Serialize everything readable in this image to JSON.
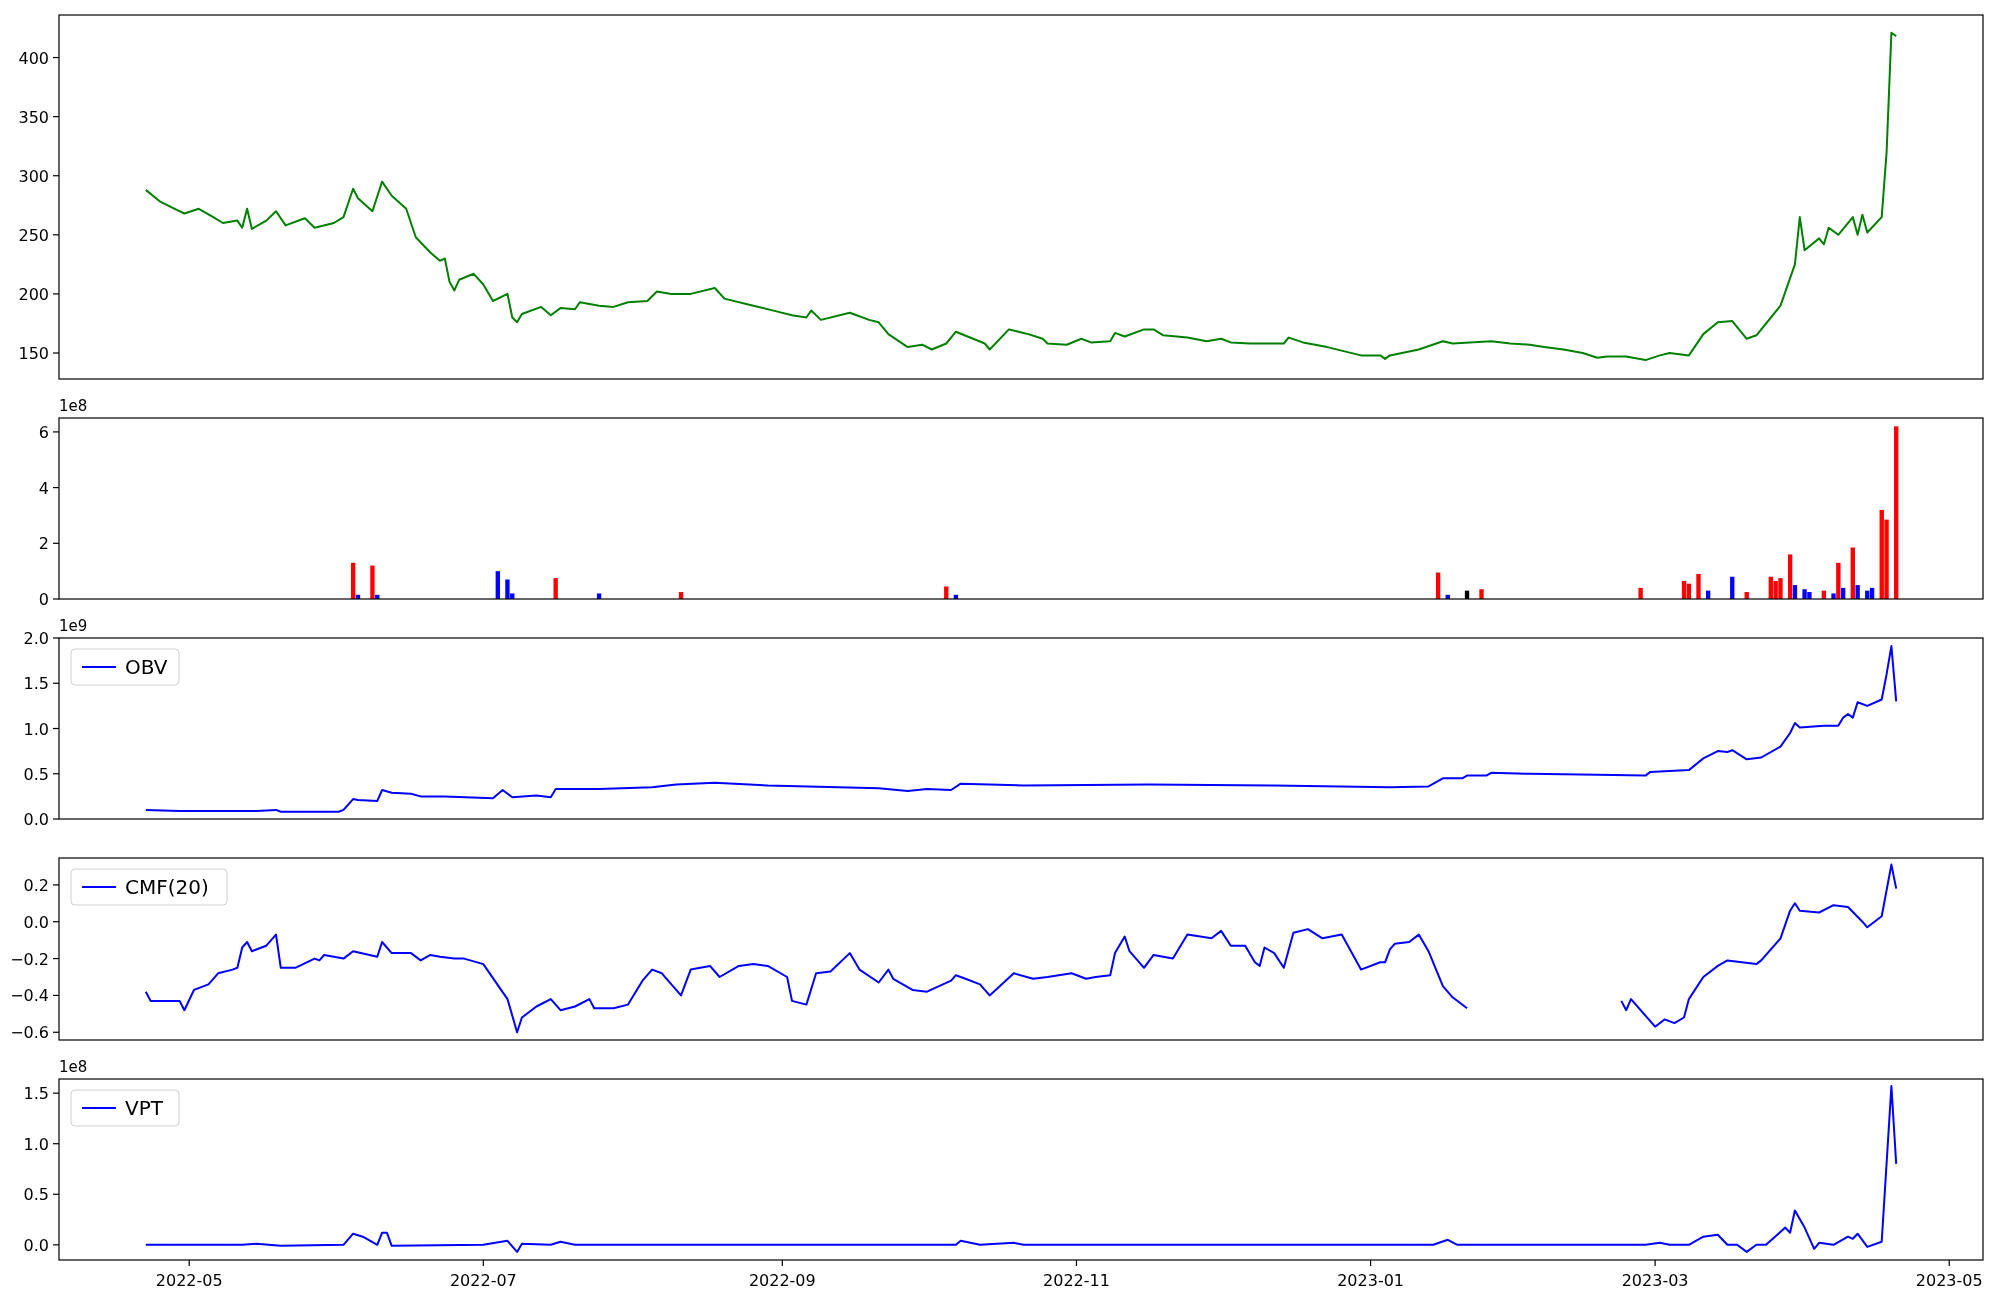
{
  "panels": [
    {
      "chart_data": {
        "type": "line",
        "xlim": [
          "2022-04-04",
          "2023-05-08"
        ],
        "ylim": [
          128,
          436
        ],
        "yticks": [
          150,
          200,
          250,
          300,
          350,
          400
        ],
        "series": [
          {
            "color": "#008000",
            "values": [
              288,
              278,
              272,
              268,
              272,
              265,
              260,
              262,
              256,
              272,
              255,
              262,
              270,
              258,
              264,
              256,
              260,
              265,
              289,
              281,
              270,
              295,
              283,
              272,
              248,
              235,
              228,
              230,
              210,
              203,
              212,
              217,
              208,
              194,
              200,
              180,
              176,
              183,
              189,
              182,
              188,
              187,
              193,
              190,
              189,
              193,
              194,
              202,
              200,
              200,
              205,
              196,
              190,
              185,
              182,
              180,
              186,
              178,
              184,
              178,
              176,
              166,
              155,
              157,
              153,
              158,
              168,
              158,
              153,
              170,
              166,
              162,
              158,
              157,
              162,
              159,
              160,
              167,
              164,
              170,
              170,
              165,
              163,
              160,
              162,
              159,
              158,
              158,
              163,
              159,
              155,
              148,
              148,
              145,
              148,
              153,
              160,
              158,
              160,
              158,
              157,
              155,
              153,
              150,
              146,
              147,
              147,
              144,
              148,
              150,
              148,
              166,
              176,
              177,
              162,
              165,
              190,
              225,
              265,
              237,
              247,
              242,
              256,
              250,
              265,
              250,
              267,
              252,
              265,
              320,
              421,
              418
            ]
          }
        ],
        "x": [
          "2022-04-22",
          "2022-04-25",
          "2022-04-28",
          "2022-04-30",
          "2022-05-03",
          "2022-05-06",
          "2022-05-08",
          "2022-05-11",
          "2022-05-12",
          "2022-05-13",
          "2022-05-14",
          "2022-05-17",
          "2022-05-19",
          "2022-05-21",
          "2022-05-25",
          "2022-05-27",
          "2022-05-31",
          "2022-06-02",
          "2022-06-04",
          "2022-06-05",
          "2022-06-08",
          "2022-06-10",
          "2022-06-12",
          "2022-06-15",
          "2022-06-17",
          "2022-06-20",
          "2022-06-22",
          "2022-06-23",
          "2022-06-24",
          "2022-06-25",
          "2022-06-26",
          "2022-06-29",
          "2022-07-01",
          "2022-07-03",
          "2022-07-06",
          "2022-07-07",
          "2022-07-08",
          "2022-07-09",
          "2022-07-13",
          "2022-07-15",
          "2022-07-17",
          "2022-07-20",
          "2022-07-21",
          "2022-07-25",
          "2022-07-28",
          "2022-07-31",
          "2022-08-04",
          "2022-08-06",
          "2022-08-09",
          "2022-08-13",
          "2022-08-18",
          "2022-08-20",
          "2022-08-26",
          "2022-08-31",
          "2022-09-03",
          "2022-09-06",
          "2022-09-07",
          "2022-09-09",
          "2022-09-15",
          "2022-09-19",
          "2022-09-21",
          "2022-09-23",
          "2022-09-27",
          "2022-09-30",
          "2022-10-02",
          "2022-10-05",
          "2022-10-07",
          "2022-10-13",
          "2022-10-14",
          "2022-10-18",
          "2022-10-22",
          "2022-10-25",
          "2022-10-26",
          "2022-10-30",
          "2022-11-02",
          "2022-11-04",
          "2022-11-08",
          "2022-11-09",
          "2022-11-11",
          "2022-11-15",
          "2022-11-17",
          "2022-11-19",
          "2022-11-24",
          "2022-11-28",
          "2022-12-01",
          "2022-12-03",
          "2022-12-07",
          "2022-12-14",
          "2022-12-15",
          "2022-12-18",
          "2022-12-23",
          "2022-12-30",
          "2023-01-03",
          "2023-01-04",
          "2023-01-05",
          "2023-01-11",
          "2023-01-16",
          "2023-01-18",
          "2023-01-26",
          "2023-01-30",
          "2023-02-03",
          "2023-02-06",
          "2023-02-10",
          "2023-02-14",
          "2023-02-17",
          "2023-02-19",
          "2023-02-23",
          "2023-02-27",
          "2023-03-02",
          "2023-03-04",
          "2023-03-08",
          "2023-03-11",
          "2023-03-14",
          "2023-03-17",
          "2023-03-20",
          "2023-03-22",
          "2023-03-27",
          "2023-03-30",
          "2023-03-31",
          "2023-04-01",
          "2023-04-04",
          "2023-04-05",
          "2023-04-06",
          "2023-04-08",
          "2023-04-11",
          "2023-04-12",
          "2023-04-13",
          "2023-04-14",
          "2023-04-17",
          "2023-04-18",
          "2023-04-19",
          "2023-04-20"
        ]
      }
    },
    {
      "offset_label": "1e8",
      "chart_data": {
        "type": "bar",
        "xlim": [
          "2022-04-04",
          "2023-05-08"
        ],
        "ylim": [
          0,
          6.5
        ],
        "yticks": [
          0,
          2,
          4,
          6
        ],
        "x": [
          "2022-06-04",
          "2022-06-05",
          "2022-06-08",
          "2022-06-09",
          "2022-07-04",
          "2022-07-06",
          "2022-07-07",
          "2022-07-16",
          "2022-07-25",
          "2022-08-11",
          "2022-10-05",
          "2022-10-07",
          "2023-01-15",
          "2023-01-17",
          "2023-01-21",
          "2023-01-24",
          "2023-02-26",
          "2023-03-07",
          "2023-03-08",
          "2023-03-10",
          "2023-03-12",
          "2023-03-17",
          "2023-03-20",
          "2023-03-25",
          "2023-03-26",
          "2023-03-27",
          "2023-03-29",
          "2023-03-30",
          "2023-04-01",
          "2023-04-02",
          "2023-04-05",
          "2023-04-07",
          "2023-04-08",
          "2023-04-09",
          "2023-04-11",
          "2023-04-12",
          "2023-04-14",
          "2023-04-15",
          "2023-04-17",
          "2023-04-18",
          "2023-04-20"
        ],
        "series": [
          {
            "color": "#ff0000",
            "values": [
              1.3,
              null,
              1.2,
              null,
              null,
              null,
              null,
              0.75,
              null,
              0.25,
              0.45,
              null,
              0.95,
              null,
              null,
              0.35,
              0.4,
              0.65,
              0.55,
              0.9,
              null,
              null,
              0.25,
              0.8,
              0.65,
              0.75,
              1.6,
              null,
              null,
              null,
              0.3,
              null,
              1.3,
              null,
              1.85,
              null,
              null,
              null,
              3.2,
              2.85,
              6.2
            ]
          },
          {
            "color": "#0000ff",
            "values": [
              null,
              0.15,
              null,
              0.15,
              1.0,
              0.7,
              0.2,
              null,
              0.2,
              null,
              null,
              0.15,
              null,
              0.15,
              null,
              null,
              null,
              null,
              null,
              null,
              0.3,
              0.8,
              null,
              null,
              null,
              null,
              null,
              0.5,
              0.35,
              0.25,
              null,
              0.2,
              null,
              0.4,
              null,
              0.5,
              0.3,
              0.4,
              null,
              null,
              null
            ]
          },
          {
            "color": "#000000",
            "values": [
              null,
              null,
              null,
              null,
              null,
              null,
              null,
              null,
              null,
              null,
              null,
              null,
              null,
              null,
              0.3,
              null,
              null,
              null,
              null,
              null,
              null,
              null,
              null,
              null,
              null,
              null,
              null,
              null,
              null,
              null,
              null,
              null,
              null,
              null,
              null,
              null,
              null,
              null,
              null,
              null,
              null
            ]
          }
        ]
      }
    },
    {
      "offset_label": "1e9",
      "chart_data": {
        "type": "line",
        "xlim": [
          "2022-04-04",
          "2023-05-08"
        ],
        "ylim": [
          0,
          2.0
        ],
        "yticks": [
          {
            "value": 0,
            "label": "0.0"
          },
          {
            "value": 0.5,
            "label": "0.5"
          },
          {
            "value": 1,
            "label": "1.0"
          },
          {
            "value": 1.5,
            "label": "1.5"
          },
          {
            "value": 2,
            "label": "2.0"
          }
        ],
        "x": [
          "2022-04-22",
          "2022-04-29",
          "2022-05-15",
          "2022-05-19",
          "2022-05-20",
          "2022-06-01",
          "2022-06-02",
          "2022-06-04",
          "2022-06-05",
          "2022-06-09",
          "2022-06-10",
          "2022-06-12",
          "2022-06-16",
          "2022-06-18",
          "2022-06-23",
          "2022-07-03",
          "2022-07-05",
          "2022-07-07",
          "2022-07-12",
          "2022-07-15",
          "2022-07-16",
          "2022-07-25",
          "2022-08-05",
          "2022-08-10",
          "2022-08-18",
          "2022-08-29",
          "2022-09-21",
          "2022-09-27",
          "2022-10-01",
          "2022-10-06",
          "2022-10-08",
          "2022-10-21",
          "2022-11-16",
          "2022-12-12",
          "2023-01-05",
          "2023-01-13",
          "2023-01-16",
          "2023-01-20",
          "2023-01-21",
          "2023-01-25",
          "2023-01-26",
          "2023-02-03",
          "2023-02-17",
          "2023-02-27",
          "2023-02-28",
          "2023-03-08",
          "2023-03-11",
          "2023-03-14",
          "2023-03-16",
          "2023-03-17",
          "2023-03-20",
          "2023-03-23",
          "2023-03-27",
          "2023-03-29",
          "2023-03-30",
          "2023-03-31",
          "2023-04-05",
          "2023-04-08",
          "2023-04-09",
          "2023-04-10",
          "2023-04-11",
          "2023-04-12",
          "2023-04-14",
          "2023-04-17",
          "2023-04-18",
          "2023-04-19",
          "2023-04-20"
        ],
        "series": [
          {
            "name": "OBV",
            "color": "#0000ff",
            "values": [
              0.1,
              0.09,
              0.09,
              0.1,
              0.08,
              0.08,
              0.1,
              0.22,
              0.21,
              0.2,
              0.32,
              0.29,
              0.28,
              0.25,
              0.25,
              0.23,
              0.32,
              0.24,
              0.26,
              0.24,
              0.33,
              0.33,
              0.35,
              0.38,
              0.4,
              0.37,
              0.34,
              0.31,
              0.33,
              0.32,
              0.39,
              0.37,
              0.38,
              0.37,
              0.35,
              0.36,
              0.45,
              0.45,
              0.48,
              0.48,
              0.51,
              0.5,
              0.49,
              0.48,
              0.52,
              0.54,
              0.67,
              0.75,
              0.74,
              0.76,
              0.66,
              0.68,
              0.8,
              0.95,
              1.06,
              1.01,
              1.03,
              1.03,
              1.12,
              1.16,
              1.12,
              1.29,
              1.25,
              1.32,
              1.6,
              1.91,
              1.3
            ]
          }
        ]
      }
    },
    {
      "chart_data": {
        "type": "line",
        "xlim": [
          "2022-04-04",
          "2023-05-08"
        ],
        "ylim": [
          -0.642,
          0.346
        ],
        "yticks": [
          {
            "value": -0.6,
            "label": "−0.6"
          },
          {
            "value": -0.4,
            "label": "−0.4"
          },
          {
            "value": -0.2,
            "label": "−0.2"
          },
          {
            "value": 0,
            "label": "0.0"
          },
          {
            "value": 0.2,
            "label": "0.2"
          }
        ],
        "x": [
          "2022-04-22",
          "2022-04-23",
          "2022-04-29",
          "2022-04-30",
          "2022-05-02",
          "2022-05-05",
          "2022-05-07",
          "2022-05-10",
          "2022-05-11",
          "2022-05-12",
          "2022-05-13",
          "2022-05-14",
          "2022-05-17",
          "2022-05-19",
          "2022-05-20",
          "2022-05-23",
          "2022-05-27",
          "2022-05-28",
          "2022-05-29",
          "2022-06-02",
          "2022-06-04",
          "2022-06-09",
          "2022-06-10",
          "2022-06-12",
          "2022-06-16",
          "2022-06-18",
          "2022-06-20",
          "2022-06-22",
          "2022-06-25",
          "2022-06-27",
          "2022-07-01",
          "2022-07-06",
          "2022-07-08",
          "2022-07-09",
          "2022-07-12",
          "2022-07-15",
          "2022-07-17",
          "2022-07-20",
          "2022-07-23",
          "2022-07-24",
          "2022-07-28",
          "2022-07-31",
          "2022-08-03",
          "2022-08-05",
          "2022-08-07",
          "2022-08-11",
          "2022-08-13",
          "2022-08-17",
          "2022-08-19",
          "2022-08-23",
          "2022-08-26",
          "2022-08-29",
          "2022-09-02",
          "2022-09-03",
          "2022-09-06",
          "2022-09-08",
          "2022-09-11",
          "2022-09-15",
          "2022-09-17",
          "2022-09-21",
          "2022-09-23",
          "2022-09-24",
          "2022-09-28",
          "2022-10-01",
          "2022-10-06",
          "2022-10-07",
          "2022-10-09",
          "2022-10-12",
          "2022-10-14",
          "2022-10-19",
          "2022-10-23",
          "2022-10-26",
          "2022-10-31",
          "2022-11-03",
          "2022-11-05",
          "2022-11-08",
          "2022-11-09",
          "2022-11-11",
          "2022-11-12",
          "2022-11-15",
          "2022-11-17",
          "2022-11-21",
          "2022-11-24",
          "2022-11-29",
          "2022-12-01",
          "2022-12-03",
          "2022-12-06",
          "2022-12-08",
          "2022-12-09",
          "2022-12-10",
          "2022-12-12",
          "2022-12-14",
          "2022-12-16",
          "2022-12-19",
          "2022-12-22",
          "2022-12-26",
          "2022-12-30",
          "2023-01-03",
          "2023-01-04",
          "2023-01-05",
          "2023-01-06",
          "2023-01-09",
          "2023-01-11",
          "2023-01-13",
          "2023-01-16",
          "2023-01-18",
          "2023-01-21",
          "2023-01-26",
          "2023-02-22",
          "2023-02-23",
          "2023-02-24",
          "2023-03-01",
          "2023-03-03",
          "2023-03-05",
          "2023-03-07",
          "2023-03-08",
          "2023-03-11",
          "2023-03-14",
          "2023-03-16",
          "2023-03-19",
          "2023-03-22",
          "2023-03-23",
          "2023-03-27",
          "2023-03-29",
          "2023-03-30",
          "2023-03-31",
          "2023-04-04",
          "2023-04-07",
          "2023-04-10",
          "2023-04-13",
          "2023-04-14",
          "2023-04-17",
          "2023-04-19",
          "2023-04-20"
        ],
        "series": [
          {
            "name": "CMF(20)",
            "color": "#0000ff",
            "values": [
              -0.38,
              -0.43,
              -0.43,
              -0.48,
              -0.37,
              -0.34,
              -0.28,
              -0.26,
              -0.25,
              -0.14,
              -0.11,
              -0.16,
              -0.13,
              -0.07,
              -0.25,
              -0.25,
              -0.2,
              -0.21,
              -0.18,
              -0.2,
              -0.16,
              -0.19,
              -0.11,
              -0.17,
              -0.17,
              -0.21,
              -0.18,
              -0.19,
              -0.2,
              -0.2,
              -0.23,
              -0.42,
              -0.6,
              -0.52,
              -0.46,
              -0.42,
              -0.48,
              -0.46,
              -0.42,
              -0.47,
              -0.47,
              -0.45,
              -0.32,
              -0.26,
              -0.28,
              -0.4,
              -0.26,
              -0.24,
              -0.3,
              -0.24,
              -0.23,
              -0.24,
              -0.3,
              -0.43,
              -0.45,
              -0.28,
              -0.27,
              -0.17,
              -0.26,
              -0.33,
              -0.26,
              -0.31,
              -0.37,
              -0.38,
              -0.32,
              -0.29,
              -0.31,
              -0.34,
              -0.4,
              -0.28,
              -0.31,
              -0.3,
              -0.28,
              -0.31,
              -0.3,
              -0.29,
              -0.17,
              -0.08,
              -0.16,
              -0.25,
              -0.18,
              -0.2,
              -0.07,
              -0.09,
              -0.05,
              -0.13,
              -0.13,
              -0.22,
              -0.24,
              -0.14,
              -0.17,
              -0.25,
              -0.06,
              -0.04,
              -0.09,
              -0.07,
              -0.26,
              -0.22,
              -0.22,
              -0.15,
              -0.12,
              -0.11,
              -0.07,
              -0.16,
              -0.35,
              -0.41,
              -0.47,
              null,
              -0.43,
              -0.48,
              -0.42,
              -0.57,
              -0.53,
              -0.55,
              -0.52,
              -0.42,
              -0.3,
              -0.24,
              -0.21,
              -0.22,
              -0.23,
              -0.21,
              -0.09,
              0.06,
              0.1,
              0.06,
              0.05,
              0.09,
              0.08,
              0.0,
              -0.03,
              0.03,
              0.31,
              0.18
            ]
          }
        ]
      }
    },
    {
      "offset_label": "1e8",
      "chart_data": {
        "type": "line",
        "xlim": [
          "2022-04-04",
          "2023-05-08"
        ],
        "ylim": [
          -0.15,
          1.64
        ],
        "yticks": [
          {
            "value": 0,
            "label": "0.0"
          },
          {
            "value": 0.5,
            "label": "0.5"
          },
          {
            "value": 1,
            "label": "1.0"
          },
          {
            "value": 1.5,
            "label": "1.5"
          }
        ],
        "xticks": [
          {
            "value": "2022-05-01",
            "label": "2022-05"
          },
          {
            "value": "2022-07-01",
            "label": "2022-07"
          },
          {
            "value": "2022-09-01",
            "label": "2022-09"
          },
          {
            "value": "2022-11-01",
            "label": "2022-11"
          },
          {
            "value": "2023-01-01",
            "label": "2023-01"
          },
          {
            "value": "2023-03-01",
            "label": "2023-03"
          },
          {
            "value": "2023-05-01",
            "label": "2023-05"
          }
        ],
        "x": [
          "2022-04-22",
          "2022-05-12",
          "2022-05-15",
          "2022-05-20",
          "2022-06-02",
          "2022-06-04",
          "2022-06-06",
          "2022-06-09",
          "2022-06-10",
          "2022-06-11",
          "2022-06-12",
          "2022-07-01",
          "2022-07-06",
          "2022-07-08",
          "2022-07-09",
          "2022-07-15",
          "2022-07-17",
          "2022-07-20",
          "2022-10-07",
          "2022-10-08",
          "2022-10-12",
          "2022-10-19",
          "2022-10-21",
          "2023-01-14",
          "2023-01-17",
          "2023-01-19",
          "2023-02-27",
          "2023-03-02",
          "2023-03-04",
          "2023-03-08",
          "2023-03-11",
          "2023-03-14",
          "2023-03-16",
          "2023-03-18",
          "2023-03-20",
          "2023-03-22",
          "2023-03-24",
          "2023-03-28",
          "2023-03-29",
          "2023-03-30",
          "2023-04-01",
          "2023-04-03",
          "2023-04-04",
          "2023-04-07",
          "2023-04-10",
          "2023-04-11",
          "2023-04-12",
          "2023-04-14",
          "2023-04-17",
          "2023-04-19",
          "2023-04-20"
        ],
        "series": [
          {
            "name": "VPT",
            "color": "#0000ff",
            "values": [
              0.0,
              0.0,
              0.01,
              -0.01,
              0.0,
              0.11,
              0.08,
              0.0,
              0.12,
              0.12,
              -0.01,
              0.0,
              0.04,
              -0.07,
              0.01,
              0.0,
              0.03,
              0.0,
              0.0,
              0.04,
              0.0,
              0.02,
              0.0,
              0.0,
              0.05,
              0.0,
              0.0,
              0.02,
              0.0,
              0.0,
              0.08,
              0.1,
              0.0,
              0.0,
              -0.07,
              0.0,
              0.0,
              0.17,
              0.12,
              0.34,
              0.17,
              -0.04,
              0.02,
              0.0,
              0.08,
              0.06,
              0.11,
              -0.02,
              0.03,
              1.57,
              0.8
            ]
          }
        ]
      }
    }
  ]
}
